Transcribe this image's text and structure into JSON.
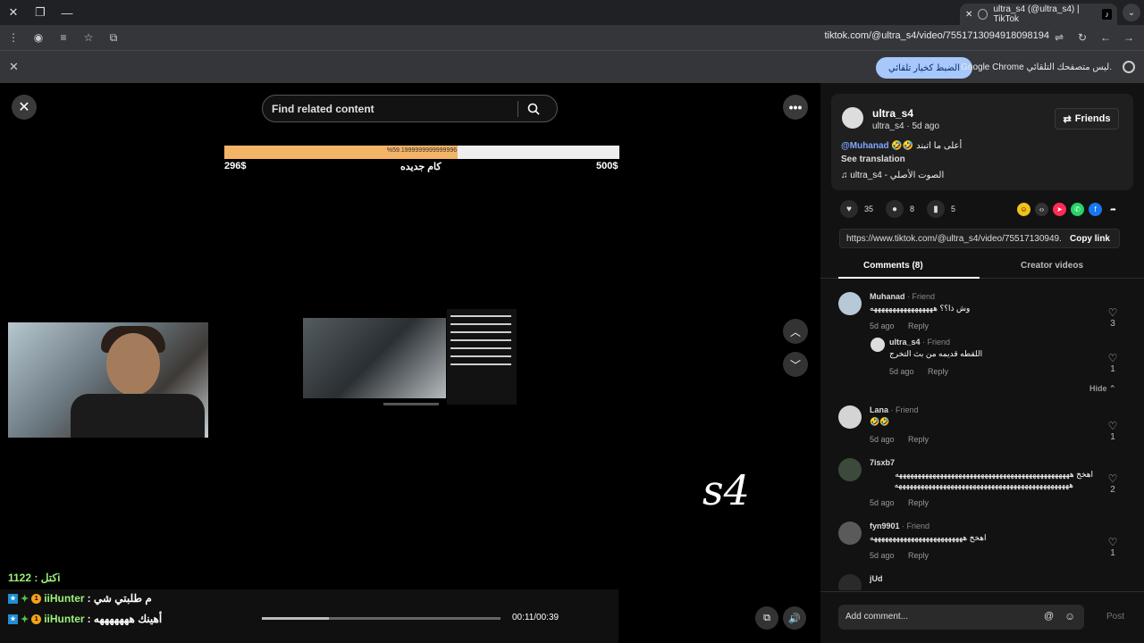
{
  "browser": {
    "tab_title": "ultra_s4 (@ultra_s4) | TikTok",
    "url": "tiktok.com/@ultra_s4/video/7551713094918098194",
    "infobar_message": "Google Chrome ليس متصفحك التلقائي.",
    "infobar_button": "الضبط كخيار تلقائي"
  },
  "video": {
    "search_placeholder": "Find related content",
    "goal_progress_text": "%59.1999999999999996",
    "goal_progress": 0.59,
    "goal_left": "296$",
    "goal_middle": "كام جديده",
    "goal_right": "500$",
    "watermark": "s4",
    "chat_line1": "كتل : 1122i",
    "chat_rows": [
      {
        "name": "iiHunter",
        "msg": ": م طلبتي شي"
      },
      {
        "name": "iiHunter",
        "msg": ": أهينك هههههههه"
      }
    ],
    "timecode": "00:11/00:39",
    "playback_progress": 0.28
  },
  "post": {
    "username": "ultra_s4",
    "meta": "ultra_s4 · 5d ago",
    "friends_label": "Friends",
    "caption_text": "🤣🤣 أعلى ما اتبند",
    "caption_mention": "@Muhanad",
    "see_translation": "See translation",
    "sound": "♫ ultra_s4 - الصوت الأصلي",
    "likes": "35",
    "comments_count": "8",
    "saves": "5",
    "link": "https://www.tiktok.com/@ultra_s4/video/75517130949...",
    "copy_link": "Copy link"
  },
  "tabs": {
    "comments": "Comments (8)",
    "creator_videos": "Creator videos"
  },
  "comments": [
    {
      "user": "Muhanad",
      "tag": " · Friend",
      "text": "وش ذا؟؟ هههههههههههههههههه",
      "date": "5d ago",
      "reply": "Reply",
      "likes": "3"
    },
    {
      "user": "ultra_s4",
      "tag": " · Friend",
      "text": "اللقطه قديمه من بث التخرج",
      "date": "5d ago",
      "reply": "Reply",
      "likes": "1"
    },
    {
      "user": "Lana",
      "tag": " · Friend",
      "text": "🤣🤣",
      "date": "5d ago",
      "reply": "Reply",
      "likes": "1"
    },
    {
      "user": "7isxb7",
      "tag": "",
      "text": "اهخخ هههههههههههههههههههههههههههههههههههههههههههههههه",
      "text2": "هههههههههههههههههههههههههههههههههههههههههههههههه",
      "date": "5d ago",
      "reply": "Reply",
      "likes": "2"
    },
    {
      "user": "fyn9901",
      "tag": " · Friend",
      "text": "اهخخ هههههههههههههههههههههههههه",
      "date": "5d ago",
      "reply": "Reply",
      "likes": "1"
    },
    {
      "user": "jUd",
      "tag": "",
      "text": "",
      "date": "",
      "reply": "",
      "likes": ""
    }
  ],
  "hide_label": "Hide ⌃",
  "composer": {
    "placeholder": "Add comment...",
    "post": "Post"
  }
}
